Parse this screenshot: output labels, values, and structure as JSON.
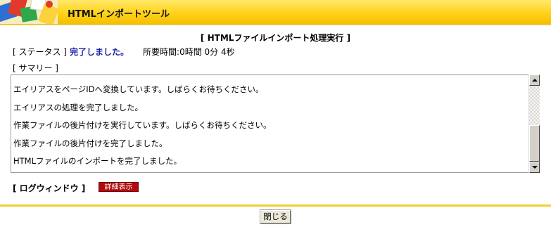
{
  "header": {
    "app_title": "HTMLインポートツール"
  },
  "page_title": "[ HTMLファイルインポート処理実行 ]",
  "status": {
    "label": "[ ステータス ]",
    "value": "完了しました。",
    "elapsed_label": "所要時間:",
    "elapsed_value": "0時間 0分 4秒"
  },
  "summary": {
    "label": "[ サマリー ]",
    "lines": [
      "エイリアスをページIDへ変換しています。しばらくお待ちください。",
      "エイリアスの処理を完了しました。",
      "作業ファイルの後片付けを実行しています。しばらくお待ちください。",
      "作業ファイルの後片付けを完了しました。",
      "HTMLファイルのインポートを完了しました。"
    ]
  },
  "log_window": {
    "label": "[ ログウィンドウ ]",
    "detail_button": "詳細表示"
  },
  "footer": {
    "close_button": "閉じる"
  },
  "colors": {
    "header_yellow": "#ffd21a",
    "status_blue": "#1b1fa8",
    "detail_button_red": "#b30b0b",
    "footer_line": "#f2cf30"
  }
}
